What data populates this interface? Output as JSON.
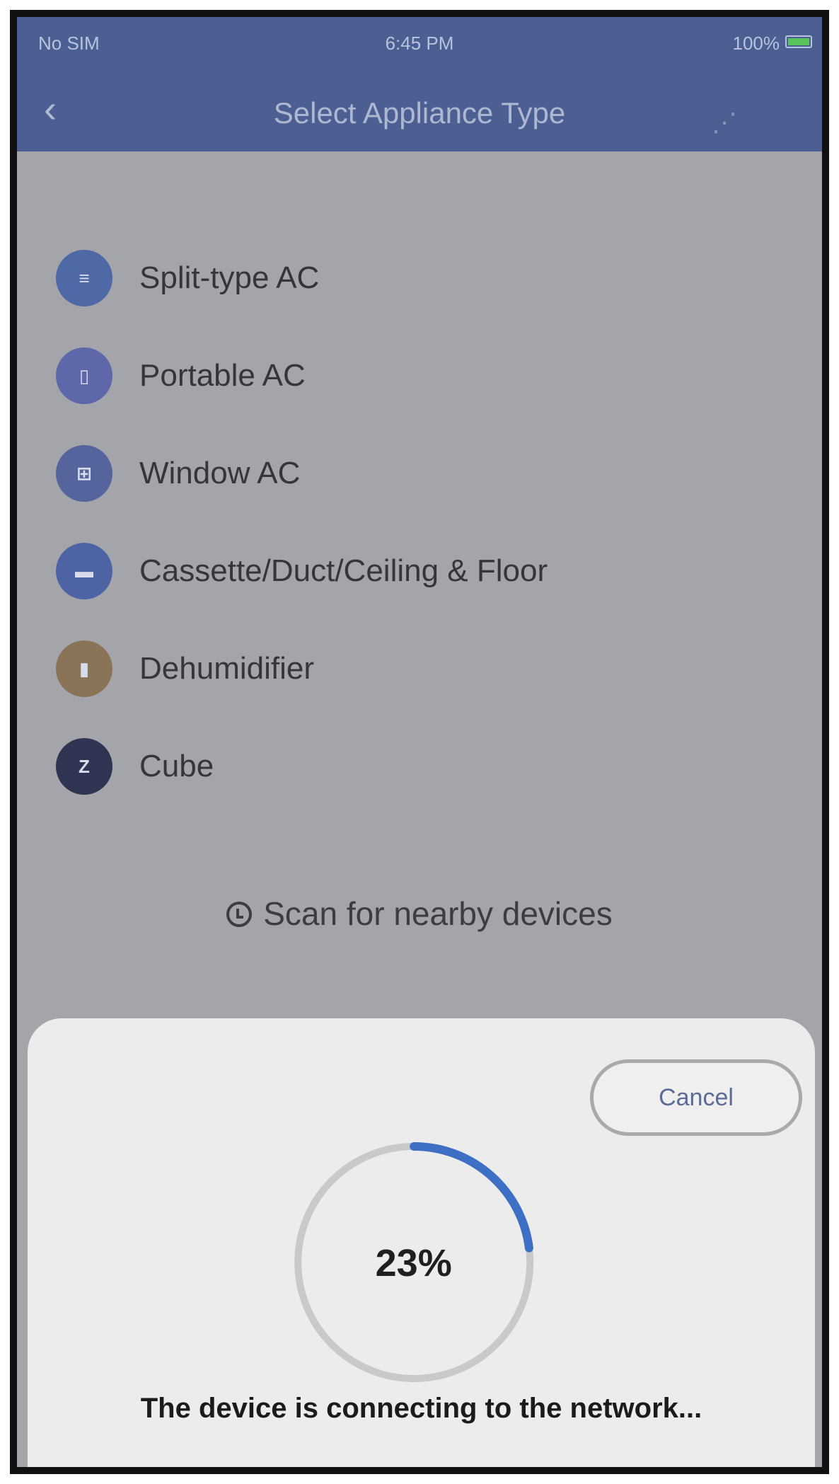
{
  "status_bar": {
    "carrier": "No SIM",
    "time": "6:45 PM",
    "battery": "100%"
  },
  "nav": {
    "title": "Select Appliance Type"
  },
  "appliances": [
    {
      "label": "Split-type AC",
      "icon": "split-ac-icon",
      "color": "#4f68a6",
      "glyph": "≡"
    },
    {
      "label": "Portable AC",
      "icon": "portable-ac-icon",
      "color": "#5d67a9",
      "glyph": "▯"
    },
    {
      "label": "Window AC",
      "icon": "window-ac-icon",
      "color": "#55649c",
      "glyph": "⊞"
    },
    {
      "label": "Cassette/Duct/Ceiling & Floor",
      "icon": "cassette-icon",
      "color": "#4e63a3",
      "glyph": "▬"
    },
    {
      "label": "Dehumidifier",
      "icon": "dehumidifier-icon",
      "color": "#8a7458",
      "glyph": "▮"
    },
    {
      "label": "Cube",
      "icon": "cube-icon",
      "color": "#2e3451",
      "glyph": "Z"
    }
  ],
  "scan": {
    "label": "Scan for nearby devices"
  },
  "sheet": {
    "cancel_label": "Cancel",
    "progress_text": "23%",
    "progress_fraction": 0.23,
    "status_text": "The device is connecting to the network..."
  },
  "colors": {
    "accent": "#3d6fc4",
    "track": "#c9c9c9"
  }
}
